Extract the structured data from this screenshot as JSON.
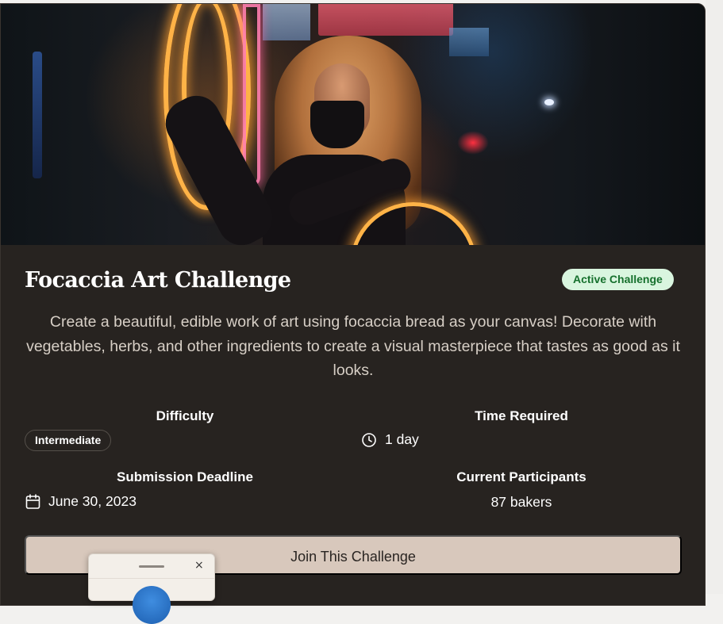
{
  "challenge": {
    "title": "Focaccia Art Challenge",
    "status_badge": "Active Challenge",
    "description": "Create a beautiful, edible work of art using focaccia bread as your canvas! Decorate with vegetables, herbs, and other ingredients to create a visual masterpiece that tastes as good as it looks.",
    "hero_alt": "challenge-cover-photo"
  },
  "stats": {
    "difficulty": {
      "label": "Difficulty",
      "value": "Intermediate"
    },
    "time": {
      "label": "Time Required",
      "value": "1 day",
      "icon": "clock-icon"
    },
    "deadline": {
      "label": "Submission Deadline",
      "value": "June 30, 2023",
      "icon": "calendar-icon"
    },
    "participants": {
      "label": "Current Participants",
      "value": "87 bakers"
    }
  },
  "actions": {
    "join_label": "Join This Challenge"
  },
  "mini_window": {
    "close_glyph": "×"
  },
  "colors": {
    "card_bg": "#272320",
    "badge_bg": "#d9f5df",
    "badge_text": "#16702d",
    "button_bg": "#d8c8bc"
  }
}
